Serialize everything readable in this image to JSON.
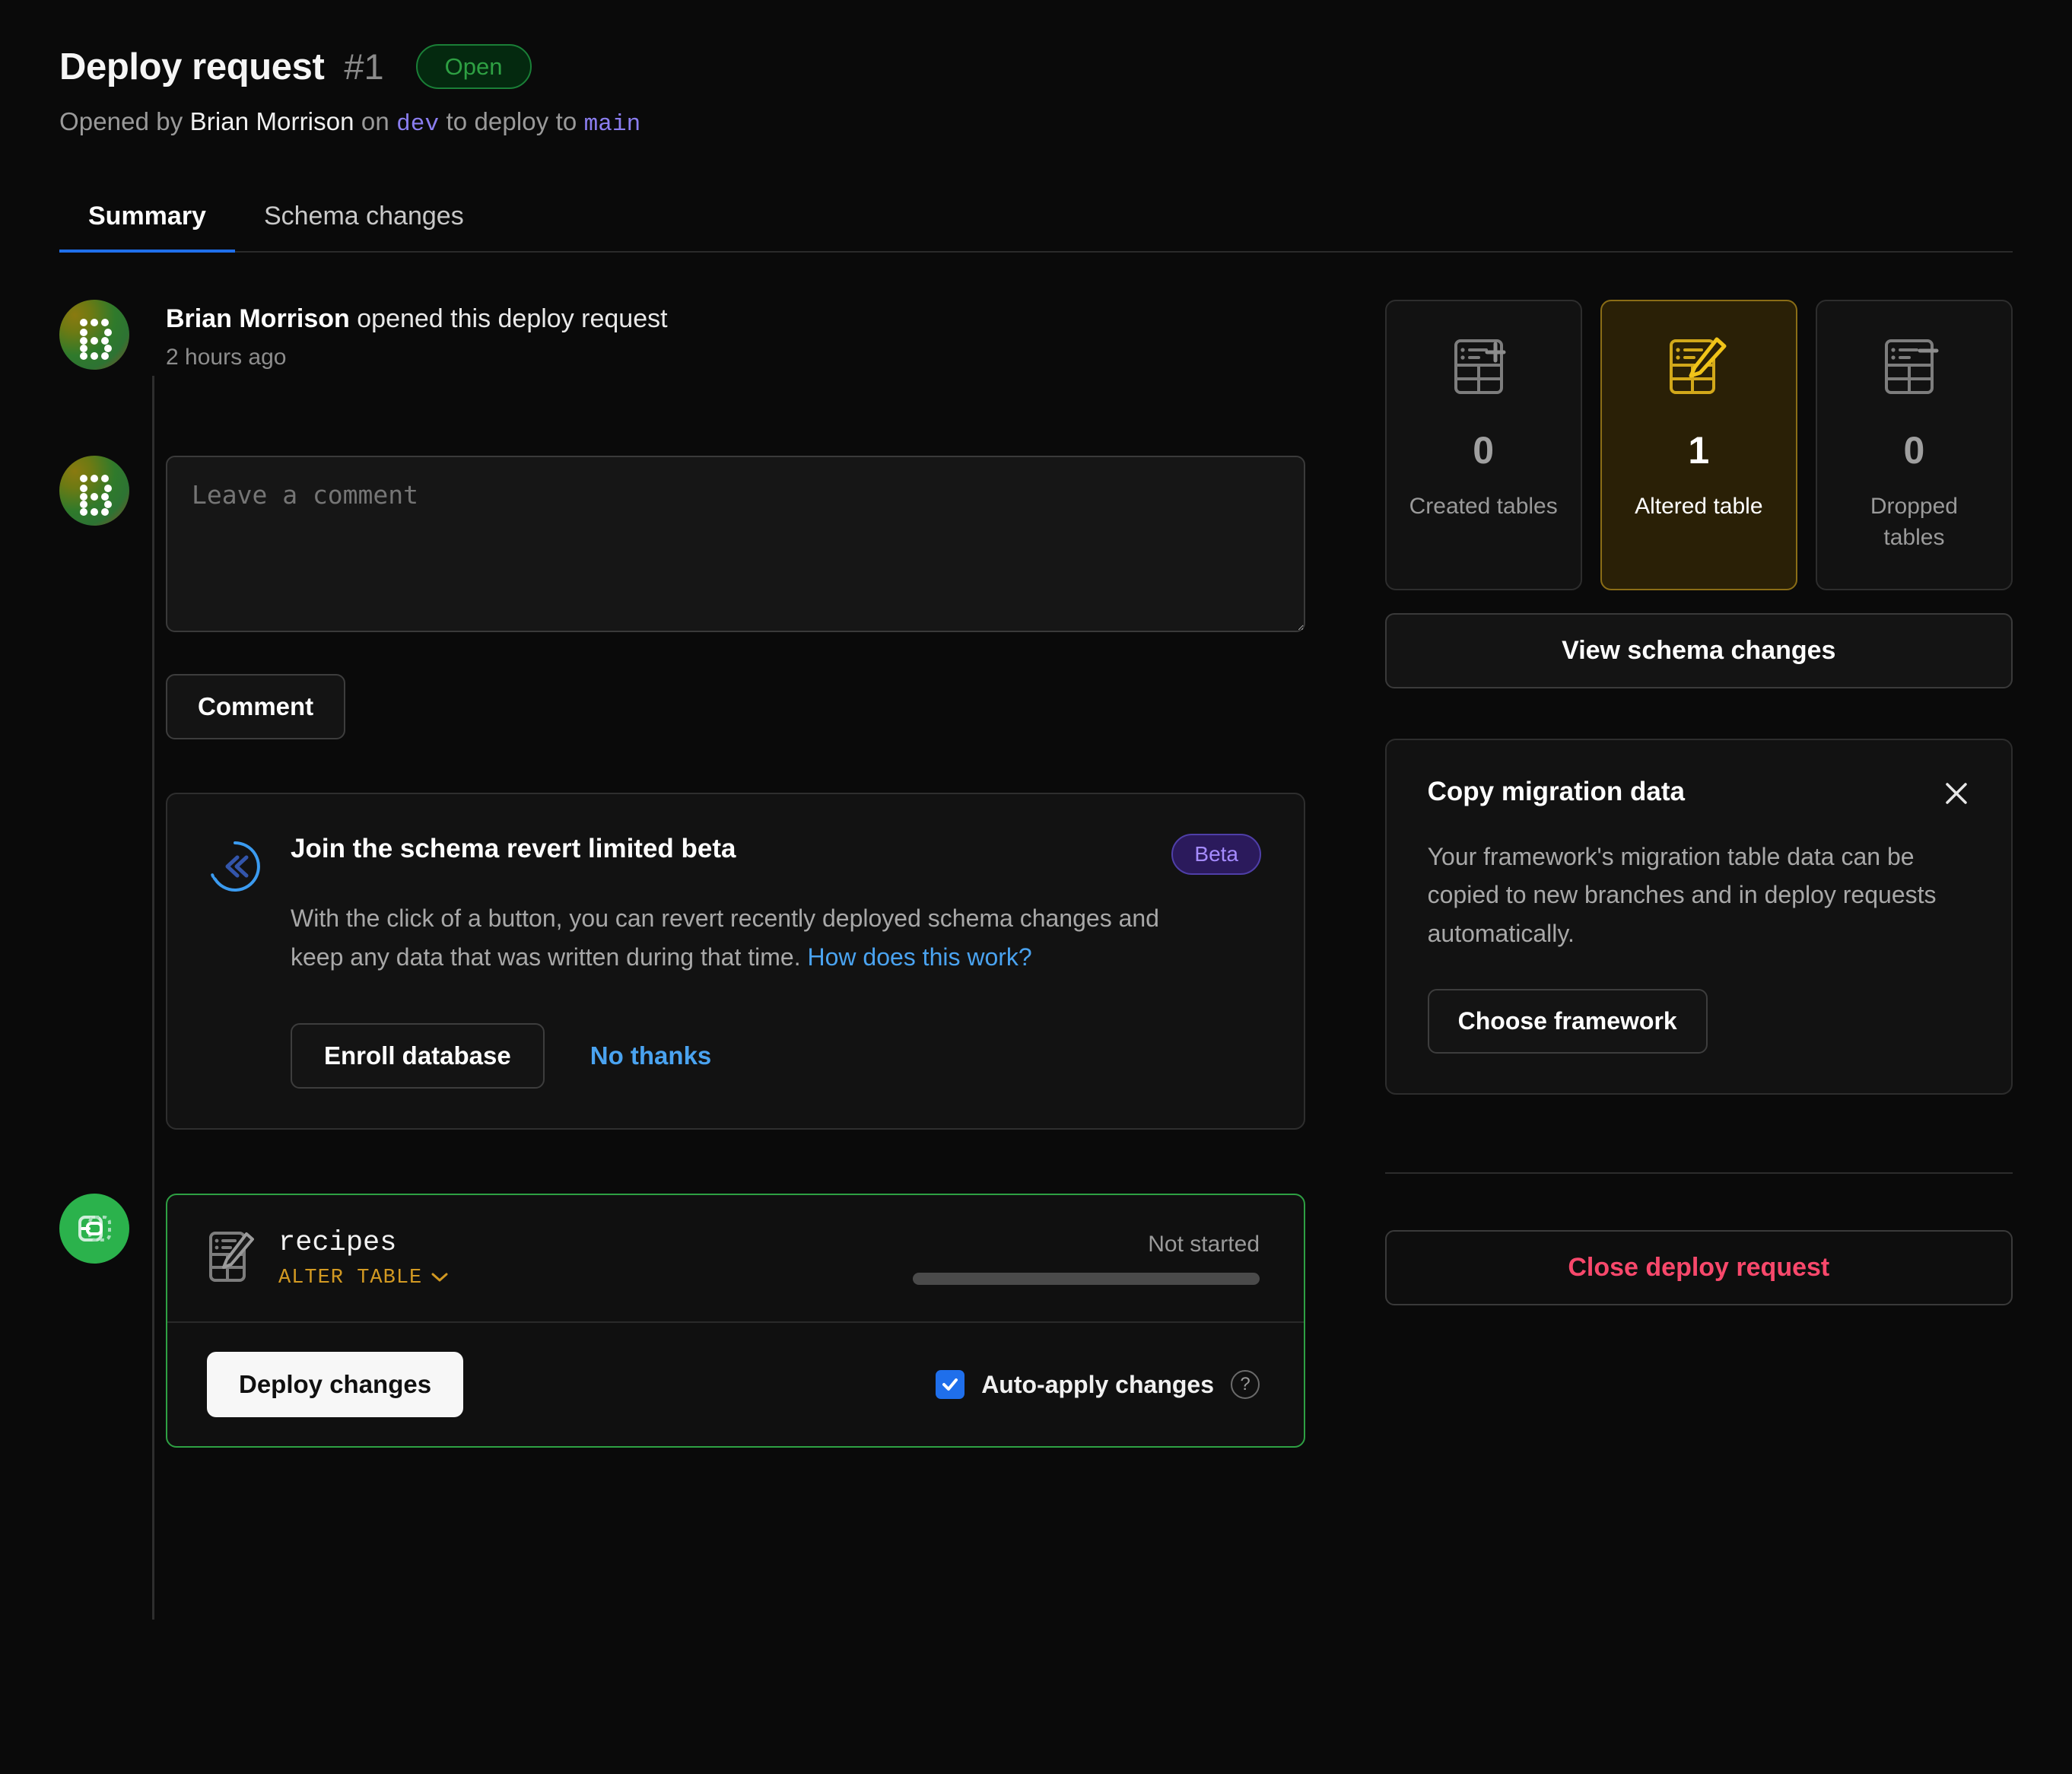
{
  "header": {
    "title": "Deploy request",
    "number": "#1",
    "status": "Open",
    "sub_opened_by": "Opened by",
    "author": "Brian Morrison",
    "sub_on": "on",
    "source_branch": "dev",
    "sub_to_deploy": "to deploy to",
    "target_branch": "main",
    "status_color": "#2ea043"
  },
  "tabs": [
    {
      "label": "Summary",
      "active": true
    },
    {
      "label": "Schema changes",
      "active": false
    }
  ],
  "timeline": {
    "event_author": "Brian Morrison",
    "event_text": "opened this deploy request",
    "event_time": "2 hours ago"
  },
  "comment": {
    "placeholder": "Leave a comment",
    "value": "",
    "submit_label": "Comment"
  },
  "beta_card": {
    "title": "Join the schema revert limited beta",
    "badge": "Beta",
    "description": "With the click of a button, you can revert recently deployed schema changes and keep any data that was written during that time. ",
    "link_text": "How does this work?",
    "primary_label": "Enroll database",
    "secondary_label": "No thanks",
    "accent_color": "#4aa3f0"
  },
  "deploy_card": {
    "table_name": "recipes",
    "operation": "ALTER TABLE",
    "operation_color": "#d29922",
    "status": "Not started",
    "progress_percent": 0,
    "deploy_label": "Deploy changes",
    "auto_apply_label": "Auto-apply changes",
    "auto_apply_checked": true,
    "border_color": "#2ea043"
  },
  "sidebar": {
    "stats": [
      {
        "count": "0",
        "label": "Created tables",
        "icon": "table-plus-icon",
        "highlighted": false
      },
      {
        "count": "1",
        "label": "Altered table",
        "icon": "table-edit-icon",
        "highlighted": true
      },
      {
        "count": "0",
        "label": "Dropped tables",
        "icon": "table-minus-icon",
        "highlighted": false
      }
    ],
    "view_schema_label": "View schema changes",
    "migration": {
      "title": "Copy migration data",
      "description": "Your framework's migration table data can be copied to new branches and in deploy requests automatically.",
      "button_label": "Choose framework"
    },
    "close_label": "Close deploy request",
    "close_color": "#f8486b"
  }
}
